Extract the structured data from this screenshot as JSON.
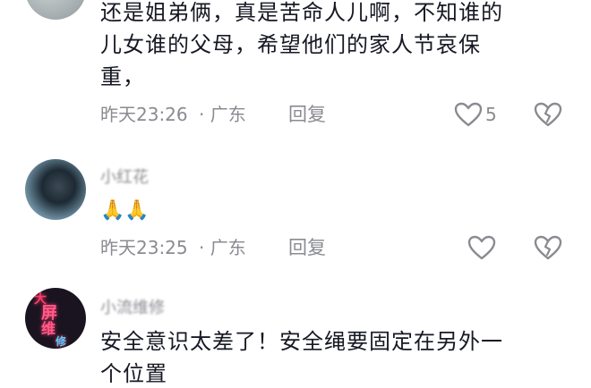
{
  "comments": [
    {
      "text_lines": [
        "还是姐弟俩，真是苦命人儿啊，不知谁的",
        "儿女谁的父母，希望他们的家人节哀保",
        "重，"
      ],
      "time": "昨天23:26",
      "location": "· 广东",
      "reply_label": "回复",
      "like_count": "5"
    },
    {
      "username": "小红花",
      "text": "🙏🙏",
      "time": "昨天23:25",
      "location": "· 广东",
      "reply_label": "回复"
    },
    {
      "username": "小流维修",
      "avatar_text": [
        "大",
        "屏",
        "维",
        "修"
      ],
      "text_lines": [
        "安全意识太差了！安全绳要固定在另外一",
        "个位置"
      ]
    }
  ],
  "colors": {
    "text": "#161823",
    "meta": "#8a8b91"
  },
  "icons": [
    "heart-outline-icon",
    "broken-heart-icon"
  ]
}
